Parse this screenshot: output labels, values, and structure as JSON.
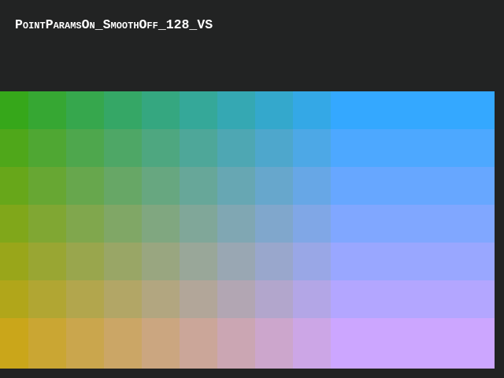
{
  "window": {
    "title": "PointParamsOn_SmoothOff_128_VS"
  },
  "colors": {
    "background": "#222323",
    "top_left": "#36a71a",
    "top_right": "#34a8ff",
    "bottom_left": "#caa61a",
    "bottom_right": "#cca6ff"
  },
  "grid": {
    "rows": 7,
    "columns": 10
  }
}
